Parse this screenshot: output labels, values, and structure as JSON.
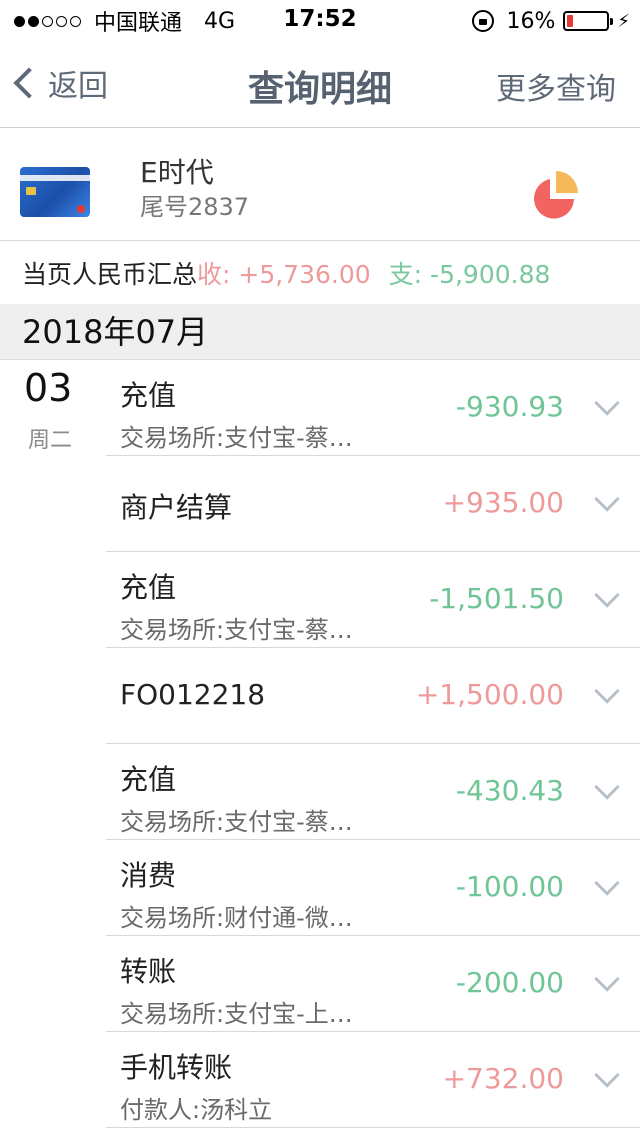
{
  "status_bar": {
    "signal_dots": [
      true,
      true,
      false,
      false,
      false
    ],
    "carrier": "中国联通",
    "network": "4G",
    "time": "17:52",
    "battery_percent_text": "16%",
    "battery_level": 0.16
  },
  "nav": {
    "back_label": "返回",
    "title": "查询明细",
    "more_label": "更多查询"
  },
  "card": {
    "name": "E时代",
    "tail": "尾号2837"
  },
  "summary": {
    "label": "当页人民币汇总",
    "income": "收: +5,736.00",
    "expense": "支: -5,900.88"
  },
  "month": "2018年07月",
  "day": {
    "number": "03",
    "weekday": "周二"
  },
  "transactions": [
    {
      "title": "充值",
      "desc": "交易场所:支付宝-蔡…",
      "amount": "-930.93",
      "sign": "neg"
    },
    {
      "title": "商户结算",
      "desc": "",
      "amount": "+935.00",
      "sign": "pos"
    },
    {
      "title": "充值",
      "desc": "交易场所:支付宝-蔡…",
      "amount": "-1,501.50",
      "sign": "neg"
    },
    {
      "title": "FO012218",
      "desc": "",
      "amount": "+1,500.00",
      "sign": "pos"
    },
    {
      "title": "充值",
      "desc": "交易场所:支付宝-蔡…",
      "amount": "-430.43",
      "sign": "neg"
    },
    {
      "title": "消费",
      "desc": "交易场所:财付通-微…",
      "amount": "-100.00",
      "sign": "neg"
    },
    {
      "title": "转账",
      "desc": "交易场所:支付宝-上…",
      "amount": "-200.00",
      "sign": "neg"
    },
    {
      "title": "手机转账",
      "desc": "付款人:汤科立",
      "amount": "+732.00",
      "sign": "pos"
    }
  ],
  "colors": {
    "income": "#ef9a9a",
    "expense": "#6fc596",
    "nav_text": "#5f6a78",
    "pie_main": "#f26462",
    "pie_slice": "#f5b95a"
  },
  "icons": [
    "chevron-left-icon",
    "pie-chart-icon",
    "chevron-down-icon",
    "lock-rotation-icon",
    "battery-icon",
    "charging-bolt-icon"
  ]
}
